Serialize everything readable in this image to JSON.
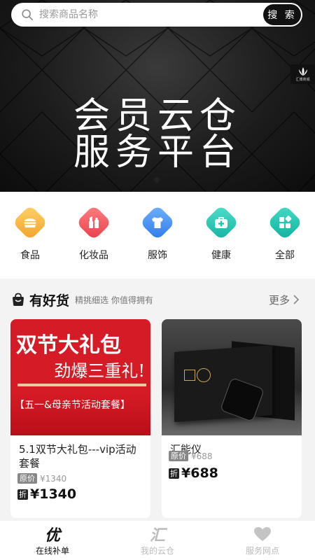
{
  "search": {
    "placeholder": "搜索商品名称",
    "button_label": "搜 索"
  },
  "banner": {
    "title_line1": "会员云仓",
    "title_line2": "服务平台",
    "logo_text": "汇博商城",
    "slide_count": 1,
    "active_slide": 1
  },
  "categories": [
    {
      "label": "食品",
      "icon": "burger-icon",
      "color": "#f6b13a"
    },
    {
      "label": "化妆品",
      "icon": "lipstick-icon",
      "color": "#f25a5e"
    },
    {
      "label": "服饰",
      "icon": "tshirt-icon",
      "color": "#3f8ff5"
    },
    {
      "label": "健康",
      "icon": "medkit-icon",
      "color": "#27c9b6"
    },
    {
      "label": "全部",
      "icon": "grid-icon",
      "color": "#1fc3b0"
    }
  ],
  "section": {
    "title": "有好货",
    "subtitle": "精挑细选 你值得拥有",
    "more_label": "更多"
  },
  "products": [
    {
      "title": "5.1双节大礼包---vip活动套餐",
      "orig_tag": "原价",
      "orig_price": "¥1340",
      "discount_tag": "折",
      "price": "¥1340",
      "image_text": {
        "line1": "双节大礼包",
        "line2": "劲爆三重礼!",
        "line3": "【五一&母亲节活动套餐】"
      }
    },
    {
      "title": "汇能仪",
      "orig_tag": "原价",
      "orig_price": "¥688",
      "discount_tag": "折",
      "price": "¥688"
    }
  ],
  "nav": [
    {
      "label": "在线补单",
      "icon_glyph": "优",
      "active": true
    },
    {
      "label": "我的云仓",
      "icon_glyph": "汇",
      "active": false
    },
    {
      "label": "服务网点",
      "icon": "heart-icon",
      "active": false
    }
  ]
}
